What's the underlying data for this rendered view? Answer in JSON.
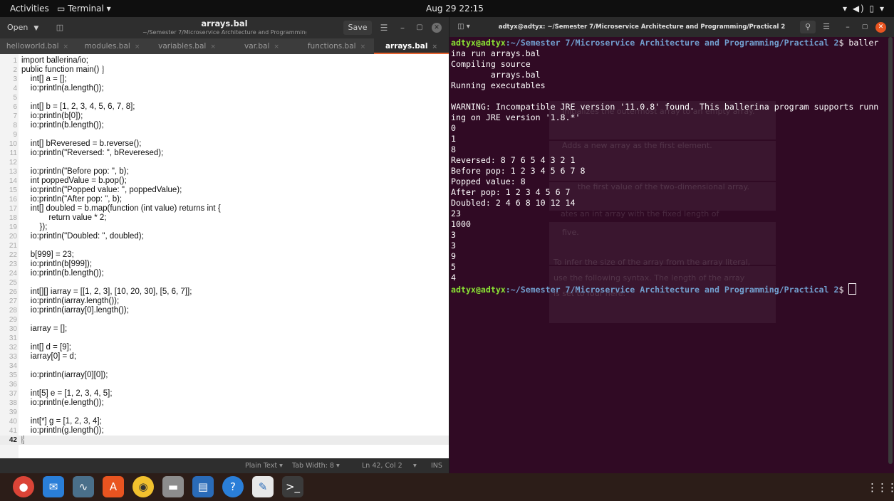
{
  "topbar": {
    "activities": "Activities",
    "app_menu": "Terminal ▾",
    "clock": "Aug 29  22:15",
    "system_tray": "▾ ◀) ▯ ▾"
  },
  "editor": {
    "open_label": "Open",
    "save_label": "Save",
    "title": "arrays.bal",
    "path": "~/Semester 7/Microservice Architecture and Programming/Practical 2",
    "tabs": [
      {
        "label": "helloworld.bal"
      },
      {
        "label": "modules.bal"
      },
      {
        "label": "variables.bal"
      },
      {
        "label": "var.bal"
      },
      {
        "label": "functions.bal"
      },
      {
        "label": "arrays.bal"
      }
    ],
    "lines": [
      {
        "n": "1",
        "t": "import ballerina/io;"
      },
      {
        "n": "2",
        "t": "public function main() "
      },
      {
        "n": "3",
        "t": "    int[] a = [];"
      },
      {
        "n": "4",
        "t": "    io:println(a.length());"
      },
      {
        "n": "5",
        "t": ""
      },
      {
        "n": "6",
        "t": "    int[] b = [1, 2, 3, 4, 5, 6, 7, 8];"
      },
      {
        "n": "7",
        "t": "    io:println(b[0]);"
      },
      {
        "n": "8",
        "t": "    io:println(b.length());"
      },
      {
        "n": "9",
        "t": ""
      },
      {
        "n": "10",
        "t": "    int[] bReveresed = b.reverse();"
      },
      {
        "n": "11",
        "t": "    io:println(\"Reversed: \", bReveresed);"
      },
      {
        "n": "12",
        "t": ""
      },
      {
        "n": "13",
        "t": "    io:println(\"Before pop: \", b);"
      },
      {
        "n": "14",
        "t": "    int poppedValue = b.pop();"
      },
      {
        "n": "15",
        "t": "    io:println(\"Popped value: \", poppedValue);"
      },
      {
        "n": "16",
        "t": "    io:println(\"After pop: \", b);"
      },
      {
        "n": "17",
        "t": "    int[] doubled = b.map(function (int value) returns int {"
      },
      {
        "n": "18",
        "t": "            return value * 2;"
      },
      {
        "n": "19",
        "t": "        });"
      },
      {
        "n": "20",
        "t": "    io:println(\"Doubled: \", doubled);"
      },
      {
        "n": "21",
        "t": ""
      },
      {
        "n": "22",
        "t": "    b[999] = 23;"
      },
      {
        "n": "23",
        "t": "    io:println(b[999]);"
      },
      {
        "n": "24",
        "t": "    io:println(b.length());"
      },
      {
        "n": "25",
        "t": ""
      },
      {
        "n": "26",
        "t": "    int[][] iarray = [[1, 2, 3], [10, 20, 30], [5, 6, 7]];"
      },
      {
        "n": "27",
        "t": "    io:println(iarray.length());"
      },
      {
        "n": "28",
        "t": "    io:println(iarray[0].length());"
      },
      {
        "n": "29",
        "t": ""
      },
      {
        "n": "30",
        "t": "    iarray = [];"
      },
      {
        "n": "31",
        "t": ""
      },
      {
        "n": "32",
        "t": "    int[] d = [9];"
      },
      {
        "n": "33",
        "t": "    iarray[0] = d;"
      },
      {
        "n": "34",
        "t": ""
      },
      {
        "n": "35",
        "t": "    io:println(iarray[0][0]);"
      },
      {
        "n": "36",
        "t": ""
      },
      {
        "n": "37",
        "t": "    int[5] e = [1, 2, 3, 4, 5];"
      },
      {
        "n": "38",
        "t": "    io:println(e.length());"
      },
      {
        "n": "39",
        "t": ""
      },
      {
        "n": "40",
        "t": "    int[*] g = [1, 2, 3, 4];"
      },
      {
        "n": "41",
        "t": "    io:println(g.length());"
      },
      {
        "n": "42",
        "t": ""
      }
    ],
    "open_bracket": "{",
    "close_bracket": "}",
    "status": {
      "language": "Plain Text ▾",
      "tab_width": "Tab Width: 8 ▾",
      "position": "Ln 42, Col 2",
      "mode_caret": "▾",
      "mode": "INS"
    }
  },
  "terminal": {
    "title": "adtyx@adtyx: ~/Semester 7/Microservice Architecture and Programming/Practical 2",
    "prompt_user": "adtyx@adtyx",
    "prompt_path": ":~/Semester 7/Microservice Architecture and Programming/Practical 2",
    "prompt_sym": "$ ",
    "command_part1": "baller",
    "lines": [
      "ina run arrays.bal",
      "Compiling source",
      "        arrays.bal",
      "Running executables",
      "",
      "WARNING: Incompatible JRE version '11.0.8' found. This ballerina program supports runn",
      "ing on JRE version '1.8.*'",
      "0",
      "1",
      "8",
      "Reversed: 8 7 6 5 4 3 2 1",
      "Before pop: 1 2 3 4 5 6 7 8",
      "Popped value: 8",
      "After pop: 1 2 3 4 5 6 7",
      "Doubled: 2 4 6 8 10 12 14",
      "23",
      "1000",
      "3",
      "3",
      "9",
      "5",
      "4"
    ],
    "ghost": [
      "Initializes the outermost array to an empty array.",
      "Adds a new array as the first element.",
      "the first value of the two-dimensional array.",
      "ates an  int  array with the fixed length of",
      "five.",
      "To infer the size of the array from the array literal,",
      "use the following syntax. The length of the array",
      "is set to four here."
    ]
  },
  "dock": {
    "apps": [
      {
        "name": "chrome-icon",
        "glyph": "●",
        "color": "#db4437"
      },
      {
        "name": "thunderbird-icon",
        "glyph": "✉",
        "color": "#2a7ed8"
      },
      {
        "name": "system-monitor-icon",
        "glyph": "∿",
        "color": "#4a6f8a"
      },
      {
        "name": "software-center-icon",
        "glyph": "A",
        "color": "#e95420"
      },
      {
        "name": "rhythmbox-icon",
        "glyph": "◉",
        "color": "#f2c12e"
      },
      {
        "name": "files-icon",
        "glyph": "▬",
        "color": "#8d8d8d"
      },
      {
        "name": "libreoffice-writer-icon",
        "glyph": "▤",
        "color": "#2a6bb8"
      },
      {
        "name": "help-icon",
        "glyph": "?",
        "color": "#2a7ed8"
      },
      {
        "name": "text-editor-icon",
        "glyph": "✎",
        "color": "#e8e8e8"
      },
      {
        "name": "terminal-icon",
        "glyph": ">_",
        "color": "#3b3b3b"
      }
    ],
    "show_apps": "⋮⋮⋮"
  }
}
